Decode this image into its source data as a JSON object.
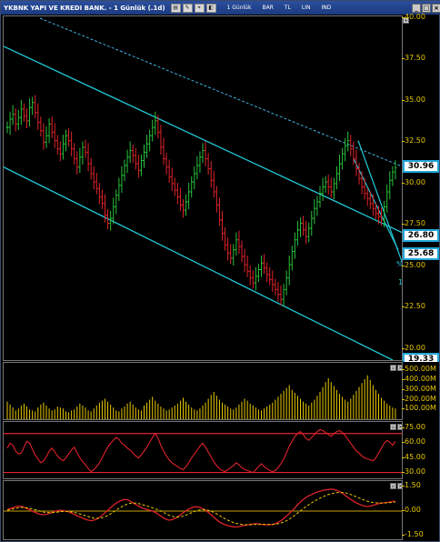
{
  "window": {
    "title": "YKBNK YAPI VE KREDI BANK. - 1 Günlük (.1d)",
    "toolbar_items": [
      "TL",
      "IND",
      "LIN",
      "BAR",
      "1 Günlük"
    ],
    "toolbar_labels": {
      "timeframe": "1 Günlük",
      "chart_type": "BAR",
      "currency": "TL",
      "scale": "LIN",
      "indicator": "IND"
    }
  },
  "price_panel": {
    "axis_ticks": [
      "40.00",
      "37.50",
      "35.00",
      "32.50",
      "30.00",
      "27.50",
      "25.00",
      "22.50",
      "20.00"
    ],
    "last_price": "30.96",
    "level_1": "26.80",
    "level_2": "25.68",
    "bottom_label": "19.33",
    "annotation_pct": "%",
    "annotation_15": "15",
    "colors": {
      "up": "#27c13a",
      "down": "#e0222a",
      "channel": "#22c8d8",
      "dashed": "#3fb0e0"
    }
  },
  "volume_panel": {
    "axis_ticks": [
      "500.00M",
      "400.00M",
      "300.00M",
      "200.00M",
      "100.00M"
    ],
    "color": "#e8c800"
  },
  "rsi_panel": {
    "axis_ticks": [
      "75.00",
      "60.00",
      "45.00",
      "30.00"
    ],
    "color": "#e0222a"
  },
  "macd_panel": {
    "axis_ticks": [
      "1.50",
      "0.00",
      "-1.50"
    ],
    "colors": {
      "macd": "#e0222a",
      "signal": "#e8c800"
    }
  },
  "chart_data": [
    {
      "type": "candlestick",
      "title": "YKBNK YAPI VE KREDI BANK. - 1 Günlük (.1d)",
      "ylim": [
        19.33,
        40.0
      ],
      "x_count": 140,
      "close": [
        33.4,
        33.9,
        34.2,
        33.6,
        34.0,
        34.5,
        34.1,
        33.8,
        34.6,
        34.9,
        34.3,
        33.7,
        33.2,
        32.5,
        32.9,
        33.6,
        33.1,
        32.6,
        32.1,
        31.8,
        32.4,
        32.9,
        32.6,
        32.1,
        31.5,
        31.0,
        31.6,
        32.2,
        31.9,
        31.2,
        30.6,
        30.1,
        29.7,
        29.2,
        28.8,
        28.1,
        27.6,
        27.9,
        28.6,
        29.3,
        29.9,
        30.5,
        31.1,
        31.6,
        32.0,
        31.7,
        31.2,
        30.8,
        31.4,
        31.9,
        32.4,
        32.9,
        33.4,
        33.8,
        33.1,
        32.2,
        31.5,
        31.0,
        30.4,
        30.0,
        29.6,
        29.2,
        28.7,
        28.4,
        28.9,
        29.5,
        30.1,
        30.6,
        31.1,
        31.6,
        32.0,
        31.5,
        30.9,
        30.2,
        29.5,
        28.7,
        27.8,
        27.0,
        26.3,
        25.8,
        25.5,
        26.0,
        26.6,
        26.2,
        25.6,
        25.1,
        24.7,
        24.3,
        24.0,
        24.4,
        24.8,
        25.2,
        24.9,
        24.5,
        24.2,
        23.9,
        23.6,
        23.3,
        23.0,
        23.6,
        24.3,
        25.1,
        25.9,
        26.6,
        27.2,
        27.6,
        27.2,
        26.8,
        27.3,
        27.9,
        28.5,
        28.9,
        29.4,
        29.8,
        30.1,
        29.8,
        29.5,
        30.0,
        30.6,
        31.2,
        31.8,
        32.3,
        32.6,
        32.1,
        31.5,
        30.9,
        30.3,
        29.8,
        29.4,
        29.1,
        28.8,
        28.5,
        28.2,
        28.0,
        27.8,
        28.6,
        29.5,
        30.2,
        30.7,
        30.96
      ],
      "volume_M": [
        180,
        150,
        120,
        90,
        110,
        140,
        160,
        130,
        100,
        90,
        80,
        120,
        150,
        170,
        140,
        110,
        90,
        100,
        130,
        120,
        110,
        80,
        70,
        90,
        100,
        130,
        160,
        140,
        120,
        90,
        80,
        110,
        140,
        170,
        190,
        210,
        180,
        150,
        120,
        90,
        80,
        110,
        130,
        160,
        180,
        150,
        120,
        100,
        90,
        140,
        170,
        200,
        230,
        190,
        160,
        130,
        110,
        90,
        100,
        120,
        140,
        160,
        190,
        220,
        180,
        150,
        120,
        100,
        90,
        110,
        140,
        170,
        210,
        250,
        280,
        240,
        200,
        170,
        150,
        130,
        110,
        100,
        120,
        150,
        180,
        210,
        190,
        160,
        140,
        120,
        100,
        90,
        110,
        130,
        150,
        170,
        200,
        230,
        260,
        290,
        320,
        350,
        300,
        270,
        240,
        210,
        180,
        160,
        140,
        170,
        200,
        240,
        280,
        330,
        380,
        420,
        380,
        340,
        300,
        260,
        230,
        200,
        180,
        210,
        250,
        290,
        330,
        370,
        410,
        450,
        400,
        350,
        300,
        260,
        220,
        190,
        160,
        140,
        120,
        110
      ],
      "rsi": [
        55,
        60,
        58,
        52,
        49,
        50,
        56,
        62,
        60,
        54,
        48,
        44,
        40,
        42,
        46,
        52,
        55,
        51,
        47,
        44,
        42,
        45,
        49,
        53,
        56,
        50,
        45,
        41,
        38,
        34,
        31,
        33,
        36,
        40,
        45,
        51,
        56,
        60,
        63,
        66,
        64,
        60,
        58,
        55,
        53,
        50,
        47,
        45,
        48,
        52,
        56,
        61,
        66,
        70,
        65,
        58,
        52,
        47,
        43,
        40,
        38,
        36,
        34,
        33,
        36,
        40,
        45,
        49,
        53,
        57,
        60,
        56,
        51,
        46,
        41,
        37,
        34,
        32,
        31,
        33,
        35,
        37,
        40,
        38,
        35,
        33,
        32,
        31,
        30,
        33,
        36,
        39,
        36,
        34,
        32,
        31,
        32,
        35,
        39,
        44,
        50,
        57,
        62,
        67,
        70,
        72,
        69,
        65,
        63,
        66,
        69,
        72,
        74,
        73,
        71,
        69,
        67,
        70,
        72,
        73,
        71,
        68,
        64,
        60,
        56,
        52,
        50,
        47,
        45,
        44,
        43,
        42,
        45,
        50,
        55,
        60,
        63,
        61,
        58,
        62
      ],
      "macd": [
        0.1,
        0.15,
        0.2,
        0.25,
        0.3,
        0.28,
        0.22,
        0.15,
        0.08,
        0.0,
        -0.08,
        -0.15,
        -0.2,
        -0.22,
        -0.2,
        -0.15,
        -0.08,
        -0.02,
        0.03,
        0.05,
        0.04,
        0.0,
        -0.05,
        -0.12,
        -0.2,
        -0.28,
        -0.35,
        -0.42,
        -0.5,
        -0.55,
        -0.58,
        -0.55,
        -0.48,
        -0.38,
        -0.25,
        -0.1,
        0.05,
        0.2,
        0.35,
        0.48,
        0.58,
        0.65,
        0.7,
        0.68,
        0.6,
        0.5,
        0.4,
        0.3,
        0.22,
        0.15,
        0.1,
        0.05,
        0.0,
        -0.08,
        -0.18,
        -0.3,
        -0.42,
        -0.5,
        -0.55,
        -0.52,
        -0.45,
        -0.35,
        -0.22,
        -0.1,
        0.02,
        0.12,
        0.2,
        0.25,
        0.26,
        0.22,
        0.15,
        0.05,
        -0.08,
        -0.22,
        -0.38,
        -0.52,
        -0.65,
        -0.75,
        -0.82,
        -0.88,
        -0.92,
        -0.95,
        -0.96,
        -0.94,
        -0.9,
        -0.86,
        -0.83,
        -0.8,
        -0.78,
        -0.76,
        -0.78,
        -0.8,
        -0.82,
        -0.83,
        -0.82,
        -0.8,
        -0.75,
        -0.68,
        -0.58,
        -0.45,
        -0.3,
        -0.15,
        0.02,
        0.2,
        0.38,
        0.55,
        0.7,
        0.82,
        0.92,
        1.0,
        1.08,
        1.15,
        1.2,
        1.25,
        1.28,
        1.3,
        1.32,
        1.3,
        1.25,
        1.18,
        1.08,
        0.95,
        0.82,
        0.7,
        0.6,
        0.5,
        0.42,
        0.35,
        0.3,
        0.28,
        0.3,
        0.35,
        0.4,
        0.45,
        0.48,
        0.5,
        0.52,
        0.55,
        0.58,
        0.6
      ],
      "signal": [
        0.05,
        0.08,
        0.12,
        0.16,
        0.2,
        0.22,
        0.22,
        0.2,
        0.17,
        0.13,
        0.08,
        0.03,
        -0.02,
        -0.06,
        -0.09,
        -0.1,
        -0.1,
        -0.08,
        -0.06,
        -0.04,
        -0.02,
        -0.02,
        -0.03,
        -0.05,
        -0.08,
        -0.12,
        -0.17,
        -0.22,
        -0.28,
        -0.33,
        -0.38,
        -0.42,
        -0.44,
        -0.43,
        -0.4,
        -0.34,
        -0.26,
        -0.17,
        -0.06,
        0.05,
        0.16,
        0.26,
        0.35,
        0.42,
        0.47,
        0.49,
        0.48,
        0.45,
        0.41,
        0.36,
        0.31,
        0.26,
        0.2,
        0.14,
        0.08,
        0.0,
        -0.08,
        -0.17,
        -0.25,
        -0.31,
        -0.35,
        -0.36,
        -0.34,
        -0.3,
        -0.24,
        -0.17,
        -0.1,
        -0.03,
        0.03,
        0.07,
        0.09,
        0.08,
        0.05,
        0.0,
        -0.08,
        -0.17,
        -0.27,
        -0.37,
        -0.46,
        -0.55,
        -0.62,
        -0.69,
        -0.74,
        -0.78,
        -0.8,
        -0.82,
        -0.82,
        -0.82,
        -0.81,
        -0.8,
        -0.8,
        -0.8,
        -0.8,
        -0.8,
        -0.8,
        -0.8,
        -0.79,
        -0.76,
        -0.72,
        -0.66,
        -0.58,
        -0.48,
        -0.37,
        -0.25,
        -0.12,
        0.01,
        0.14,
        0.27,
        0.39,
        0.5,
        0.6,
        0.69,
        0.78,
        0.86,
        0.93,
        0.99,
        1.04,
        1.08,
        1.11,
        1.12,
        1.12,
        1.1,
        1.06,
        1.0,
        0.93,
        0.86,
        0.79,
        0.72,
        0.66,
        0.6,
        0.55,
        0.52,
        0.5,
        0.49,
        0.49,
        0.49,
        0.5,
        0.51,
        0.53,
        0.55
      ]
    }
  ]
}
